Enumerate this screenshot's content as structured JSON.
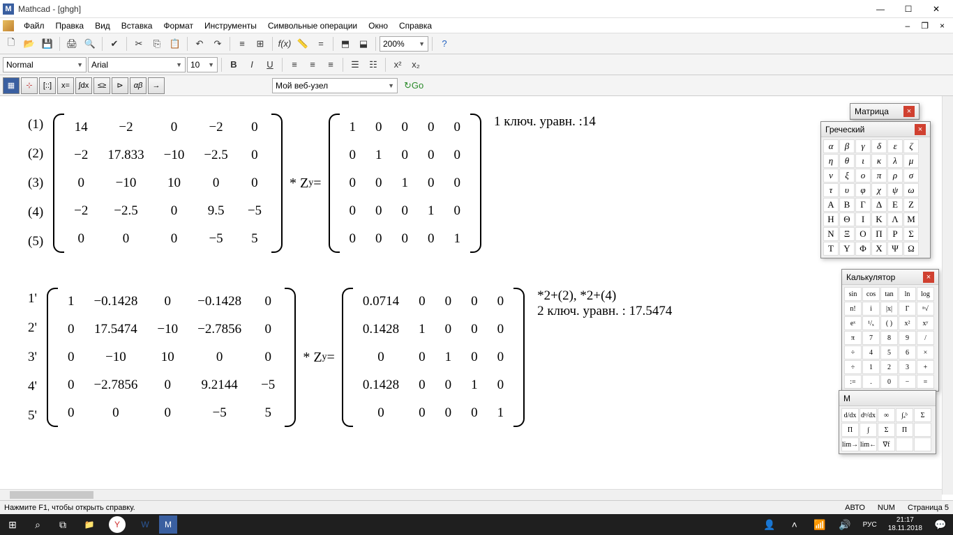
{
  "titlebar": {
    "app": "Mathcad",
    "doc": "[ghgh]"
  },
  "menu": [
    "Файл",
    "Правка",
    "Вид",
    "Вставка",
    "Формат",
    "Инструменты",
    "Символьные операции",
    "Окно",
    "Справка"
  ],
  "toolbar": {
    "style_combo": "Normal",
    "font_combo": "Arial",
    "size_combo": "10",
    "zoom": "200%",
    "web_combo": "Мой веб-узел",
    "go": "Go"
  },
  "equations": {
    "eq1": {
      "labels": [
        "(1)",
        "(2)",
        "(3)",
        "(4)",
        "(5)"
      ],
      "A": [
        [
          "14",
          "−2",
          "0",
          "−2",
          "0"
        ],
        [
          "−2",
          "17.833",
          "−10",
          "−2.5",
          "0"
        ],
        [
          "0",
          "−10",
          "10",
          "0",
          "0"
        ],
        [
          "−2",
          "−2.5",
          "0",
          "9.5",
          "−5"
        ],
        [
          "0",
          "0",
          "0",
          "−5",
          "5"
        ]
      ],
      "mid": "* Z",
      "sub": "y",
      "eq": " = ",
      "B": [
        [
          "1",
          "0",
          "0",
          "0",
          "0"
        ],
        [
          "0",
          "1",
          "0",
          "0",
          "0"
        ],
        [
          "0",
          "0",
          "1",
          "0",
          "0"
        ],
        [
          "0",
          "0",
          "0",
          "1",
          "0"
        ],
        [
          "0",
          "0",
          "0",
          "0",
          "1"
        ]
      ],
      "annot": "1 ключ. уравн. :14"
    },
    "eq2": {
      "labels": [
        "1'",
        "2'",
        "3'",
        "4'",
        "5'"
      ],
      "A": [
        [
          "1",
          "−0.1428",
          "0",
          "−0.1428",
          "0"
        ],
        [
          "0",
          "17.5474",
          "−10",
          "−2.7856",
          "0"
        ],
        [
          "0",
          "−10",
          "10",
          "0",
          "0"
        ],
        [
          "0",
          "−2.7856",
          "0",
          "9.2144",
          "−5"
        ],
        [
          "0",
          "0",
          "0",
          "−5",
          "5"
        ]
      ],
      "mid": "* Z",
      "sub": "y",
      "eq": " = ",
      "B": [
        [
          "0.0714",
          "0",
          "0",
          "0",
          "0"
        ],
        [
          "0.1428",
          "1",
          "0",
          "0",
          "0"
        ],
        [
          "0",
          "0",
          "1",
          "0",
          "0"
        ],
        [
          "0.1428",
          "0",
          "0",
          "1",
          "0"
        ],
        [
          "0",
          "0",
          "0",
          "0",
          "1"
        ]
      ],
      "annot1": "*2+(2), *2+(4)",
      "annot2": "2 ключ. уравн. : 17.5474"
    }
  },
  "palettes": {
    "matrix": {
      "title": "Матрица"
    },
    "greek": {
      "title": "Греческий",
      "lower": [
        "α",
        "β",
        "γ",
        "δ",
        "ε",
        "ζ",
        "η",
        "θ",
        "ι",
        "κ",
        "λ",
        "μ",
        "ν",
        "ξ",
        "ο",
        "π",
        "ρ",
        "σ",
        "τ",
        "υ",
        "φ",
        "χ",
        "ψ",
        "ω",
        "Α",
        "Β",
        "Γ",
        "Δ",
        "Ε",
        "Ζ",
        "Η",
        "Θ",
        "Ι",
        "Κ",
        "Λ",
        "Μ",
        "Ν",
        "Ξ",
        "Ο",
        "Π",
        "Ρ",
        "Σ",
        "Τ",
        "Υ",
        "Φ",
        "Χ",
        "Ψ",
        "Ω"
      ]
    },
    "calc": {
      "title": "Калькулятор",
      "rows": [
        [
          "sin",
          "cos",
          "tan",
          "ln",
          "log"
        ],
        [
          "n!",
          "i",
          "|x|",
          "Γ",
          "ⁿ√"
        ],
        [
          "eˣ",
          "¹/ₓ",
          "( )",
          "x²",
          "xʸ"
        ],
        [
          "π",
          "7",
          "8",
          "9",
          "/"
        ],
        [
          "÷",
          "4",
          "5",
          "6",
          "×"
        ],
        [
          "÷",
          "1",
          "2",
          "3",
          "+"
        ],
        [
          ":=",
          ".",
          "0",
          "−",
          "="
        ]
      ]
    },
    "calculus": {
      "title": "М",
      "rows": [
        [
          "d/dx",
          "dⁿ/dx",
          "∞",
          "∫ₐᵇ",
          "Σ"
        ],
        [
          "Π",
          "∫",
          "Σ",
          "Π",
          " "
        ],
        [
          "lim→",
          "lim←",
          "∇f",
          " ",
          " "
        ]
      ]
    }
  },
  "status": {
    "hint": "Нажмите F1, чтобы открыть справку.",
    "auto": "АВТО",
    "num": "NUM",
    "page": "Страница 5"
  },
  "taskbar": {
    "lang": "РУС",
    "time": "21:17",
    "date": "18.11.2018"
  }
}
